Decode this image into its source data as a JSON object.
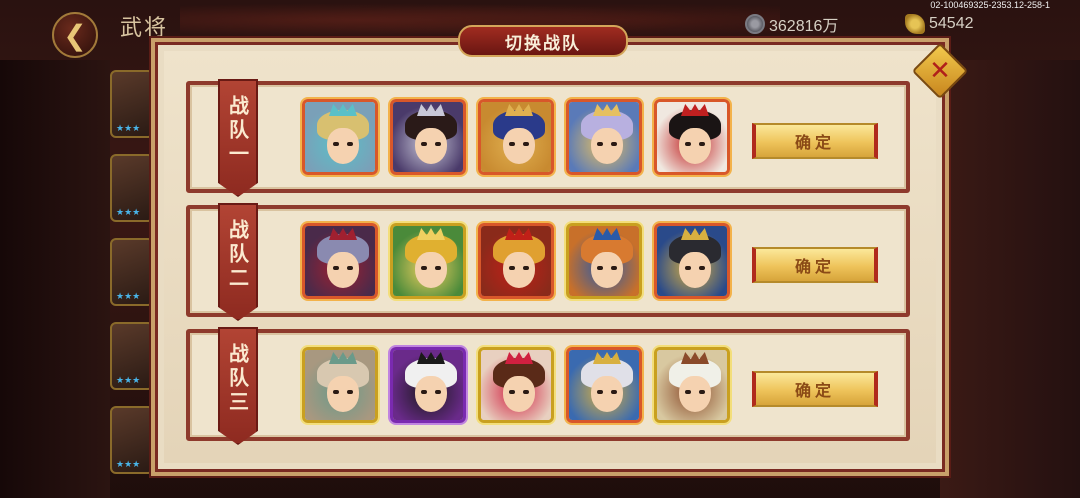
{
  "header": {
    "title": "武将",
    "currency_silver": "362816万",
    "currency_gold": "54542",
    "version": "02-100469325-2353.12-258-1"
  },
  "modal": {
    "title": "切换战队",
    "teams": [
      {
        "label": "战队一",
        "confirm_label": "确定",
        "heroes": [
          {
            "quality": "orange",
            "bg": "#7aa0b8",
            "hair": "#d8c070",
            "accent": "#5ac0c8"
          },
          {
            "quality": "orange",
            "bg": "#4a3a6a",
            "hair": "#2a1a18",
            "accent": "#c8c8d8"
          },
          {
            "quality": "orange",
            "bg": "#c88a30",
            "hair": "#2a3a8a",
            "accent": "#e0b050"
          },
          {
            "quality": "orange",
            "bg": "#5a7ab8",
            "hair": "#b8b0e0",
            "accent": "#e6c060"
          },
          {
            "quality": "orange",
            "bg": "#f0e8e0",
            "hair": "#1a1414",
            "accent": "#c02020"
          }
        ]
      },
      {
        "label": "战队二",
        "confirm_label": "确定",
        "heroes": [
          {
            "quality": "orange",
            "bg": "#4a2a4a",
            "hair": "#8a8ab0",
            "accent": "#a02030"
          },
          {
            "quality": "gold",
            "bg": "#4a8a3a",
            "hair": "#e0b030",
            "accent": "#f0d060"
          },
          {
            "quality": "orange",
            "bg": "#8a2a1a",
            "hair": "#e0a030",
            "accent": "#c02018"
          },
          {
            "quality": "gold",
            "bg": "#c8702a",
            "hair": "#d87a30",
            "accent": "#2a5aa8"
          },
          {
            "quality": "orange",
            "bg": "#2a4a8a",
            "hair": "#2a2a30",
            "accent": "#d8b040"
          }
        ]
      },
      {
        "label": "战队三",
        "confirm_label": "确定",
        "heroes": [
          {
            "quality": "gold",
            "bg": "#a89880",
            "hair": "#d8c8b0",
            "accent": "#6a9a8a"
          },
          {
            "quality": "purple",
            "bg": "#6a2a8a",
            "hair": "#f0f0f0",
            "accent": "#1a1a1a"
          },
          {
            "quality": "gold",
            "bg": "#e8d0c0",
            "hair": "#5a2a18",
            "accent": "#d02040"
          },
          {
            "quality": "orange",
            "bg": "#3a6ab0",
            "hair": "#e0e0e8",
            "accent": "#d8b040"
          },
          {
            "quality": "gold",
            "bg": "#d8c8a0",
            "hair": "#f0f0e8",
            "accent": "#8a4a2a"
          }
        ]
      }
    ]
  },
  "sidebar": {
    "cards": [
      {
        "stars": "★★★"
      },
      {
        "stars": "★★★"
      },
      {
        "stars": "★★★"
      },
      {
        "stars": "★★★"
      },
      {
        "stars": "★★★"
      }
    ]
  },
  "colors": {
    "banner": "#b24434",
    "frame": "#8e3a2c",
    "button_gold": "#eec35a",
    "parchment": "#efe4cd"
  }
}
